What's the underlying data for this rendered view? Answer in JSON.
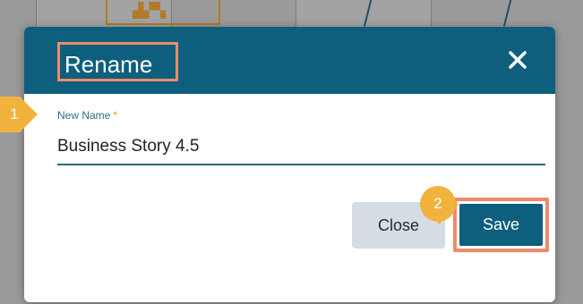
{
  "dialog": {
    "title": "Rename",
    "close_icon": "close-icon",
    "field_label": "New Name",
    "required_mark": "*",
    "name_value": "Business Story 4.5",
    "close_button_label": "Close",
    "save_button_label": "Save"
  },
  "annotations": {
    "step1_number": "1",
    "step2_number": "2"
  },
  "colors": {
    "header": "#0d5f7d",
    "highlight": "#ee8a6c",
    "marker": "#f2b33d",
    "required": "#e69a00",
    "secondary_button": "#d4dde3"
  }
}
